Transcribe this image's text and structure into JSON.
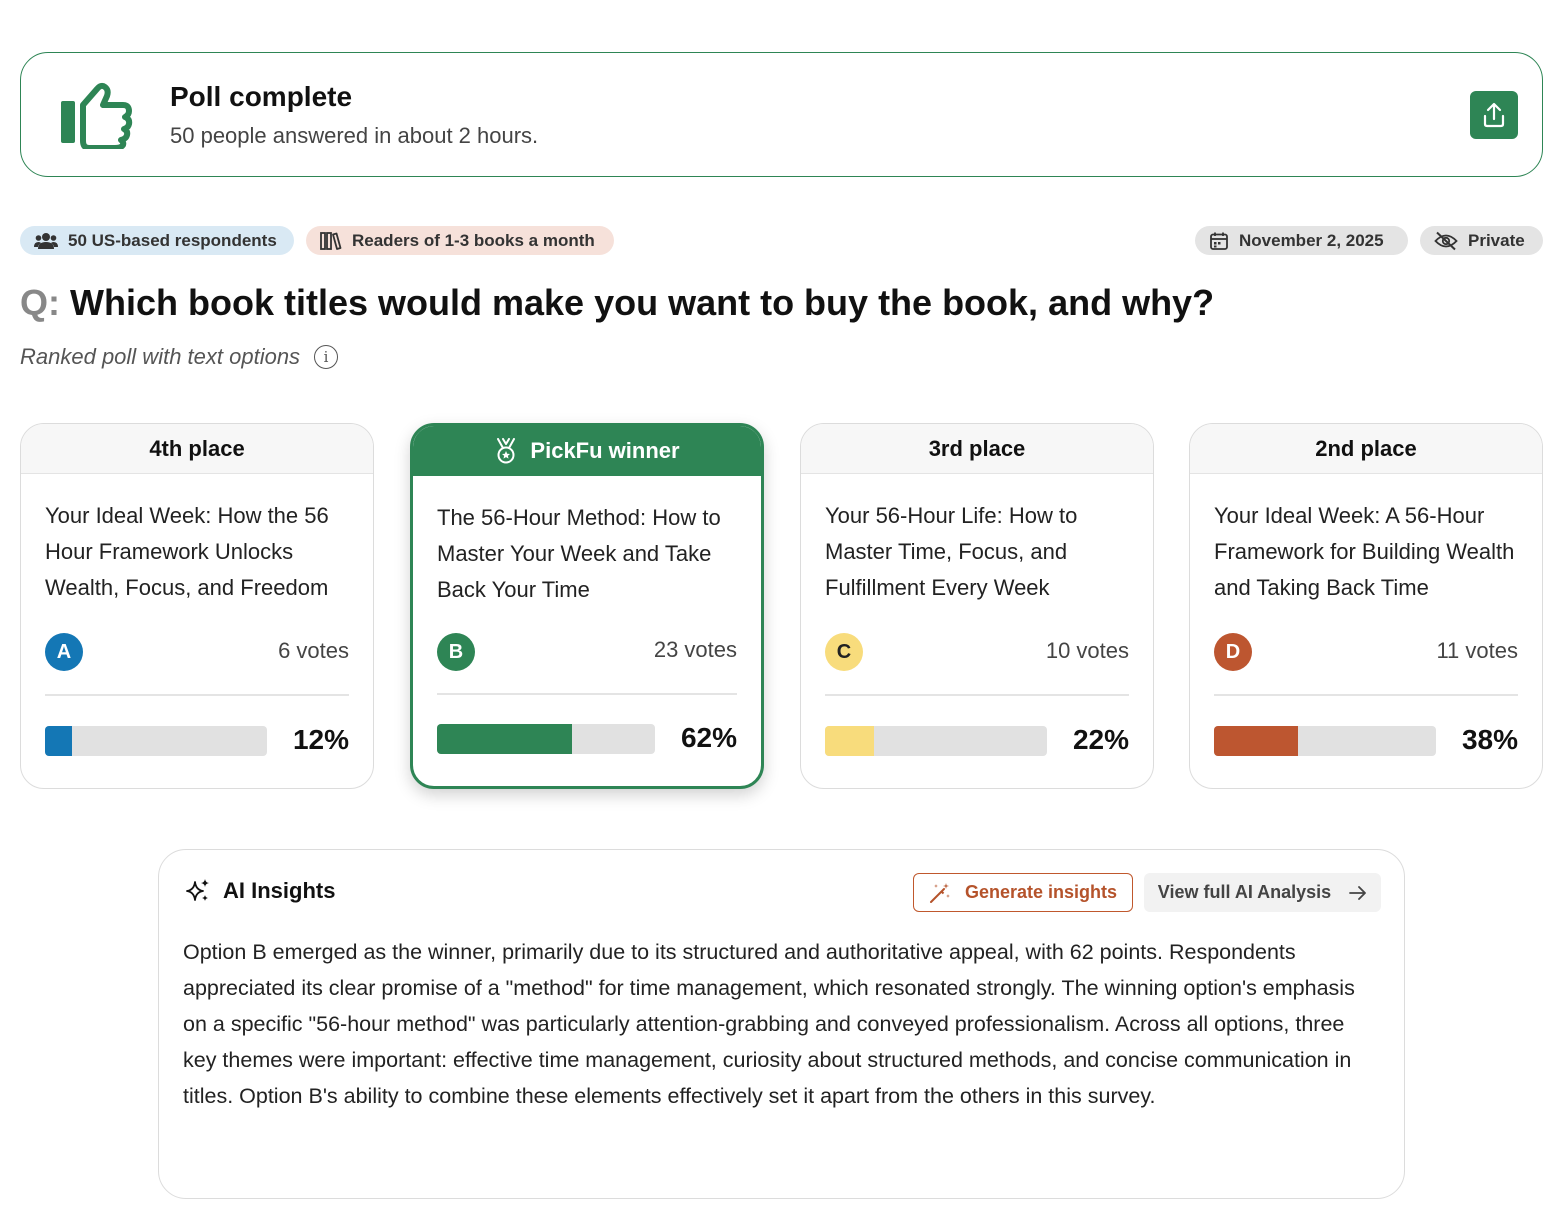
{
  "banner": {
    "title": "Poll complete",
    "subtitle": "50 people answered in about 2 hours.",
    "icons": {
      "main": "thumbs-up-icon",
      "share": "share-upload-icon"
    }
  },
  "chips": {
    "respondents": "50 US-based respondents",
    "readers": "Readers of 1-3 books a month",
    "date": "November 2, 2025",
    "privacy": "Private"
  },
  "question": {
    "prefix": "Q:",
    "text": "Which book titles would make you want to buy the book, and why?",
    "type": "Ranked poll with text options",
    "info_symbol": "i"
  },
  "options": [
    {
      "place": "4th place",
      "title": "Your Ideal Week: How the 56 Hour Framework Unlocks Wealth, Focus, and Freedom",
      "letter": "A",
      "votes": "6 votes",
      "percent": "12%",
      "percent_value": 12,
      "color": "#1477b5"
    },
    {
      "place": "PickFu winner",
      "title": "The 56-Hour Method: How to Master Your Week and Take Back Your Time",
      "letter": "B",
      "votes": "23 votes",
      "percent": "62%",
      "percent_value": 62,
      "color": "#2e8555"
    },
    {
      "place": "3rd place",
      "title": "Your 56-Hour Life: How to Master Time, Focus, and Fulfillment Every Week",
      "letter": "C",
      "votes": "10 votes",
      "percent": "22%",
      "percent_value": 22,
      "color": "#f8dc7c"
    },
    {
      "place": "2nd place",
      "title": "Your Ideal Week: A 56-Hour Framework for Building Wealth and Taking Back Time",
      "letter": "D",
      "votes": "11 votes",
      "percent": "38%",
      "percent_value": 38,
      "color": "#bd5630"
    }
  ],
  "insights": {
    "title": "AI Insights",
    "generate_label": "Generate insights",
    "view_label": "View full AI Analysis",
    "body": "Option B emerged as the winner, primarily due to its structured and authoritative appeal, with 62 points. Respondents appreciated its clear promise of a \"method\" for time management, which resonated strongly. The winning option's emphasis on a specific \"56-hour method\" was particularly attention-grabbing and conveyed professionalism. Across all options, three key themes were important: effective time management, curiosity about structured methods, and concise communication in titles. Option B's ability to combine these elements effectively set it apart from the others in this survey."
  },
  "colors": {
    "brand_green": "#2e8555",
    "accent_orange": "#b5532b"
  }
}
